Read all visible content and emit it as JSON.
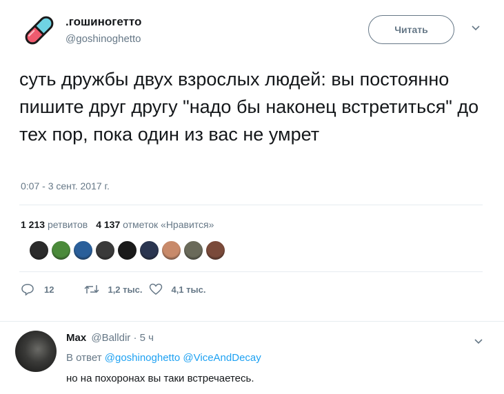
{
  "tweet": {
    "display_name": ".гошиногетто",
    "handle": "@goshinoghetto",
    "follow_label": "Читать",
    "text": "суть дружбы двух взрослых людей: вы постоянно пишите друг другу \"надо бы наконец встретиться\" до тех пор, пока один из вас не умрет",
    "timestamp": "0:07 - 3 сент. 2017 г.",
    "retweets_count": "1 213",
    "retweets_label": "ретвитов",
    "likes_count": "4 137",
    "likes_label": "отметок «Нравится»",
    "actions": {
      "reply_count": "12",
      "retweet_count": "1,2 тыс.",
      "like_count": "4,1 тыс."
    }
  },
  "likers": {
    "colors": [
      "#2b2b2b",
      "#4b8a3a",
      "#2a5f9a",
      "#3a3a3a",
      "#1a1a1a",
      "#2a3550",
      "#c88a6a",
      "#6a6a5a",
      "#7a4a3a"
    ]
  },
  "reply": {
    "name": "Max",
    "handle": "@Balldir",
    "time": "· 5 ч",
    "reply_prefix": "В ответ",
    "mention_1": "@goshinoghetto",
    "mention_2": "@ViceAndDecay",
    "text": "но на похоронах вы таки встречаетесь."
  }
}
